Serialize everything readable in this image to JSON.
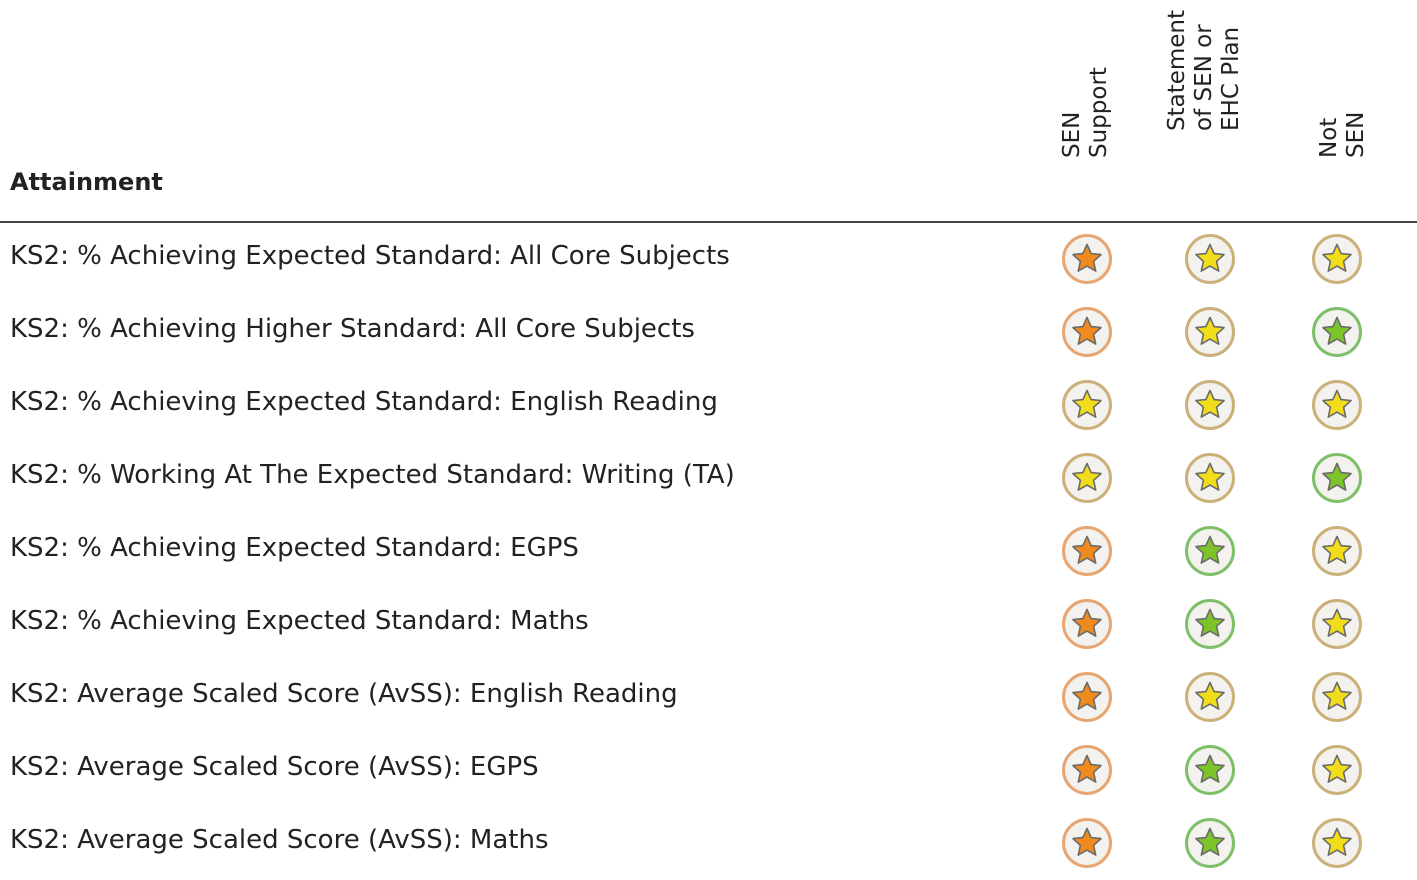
{
  "section": {
    "title": "Attainment"
  },
  "columns": [
    {
      "lines": [
        "SEN",
        "Support"
      ]
    },
    {
      "lines": [
        "Statement",
        "of SEN or",
        "EHC Plan"
      ]
    },
    {
      "lines": [
        "Not",
        "SEN"
      ]
    }
  ],
  "rating_colors": {
    "orange": "#f08a1c",
    "yellow": "#f2dd1a",
    "green": "#7cc428"
  },
  "rating_icon": "star-icon",
  "rows": [
    {
      "label": "KS2: % Achieving Expected Standard: All Core Subjects",
      "ratings": [
        "orange",
        "yellow",
        "yellow"
      ]
    },
    {
      "label": "KS2: % Achieving Higher Standard: All Core Subjects",
      "ratings": [
        "orange",
        "yellow",
        "green"
      ]
    },
    {
      "label": "KS2: % Achieving Expected Standard: English Reading",
      "ratings": [
        "yellow",
        "yellow",
        "yellow"
      ]
    },
    {
      "label": "KS2: % Working At The Expected Standard: Writing (TA)",
      "ratings": [
        "yellow",
        "yellow",
        "green"
      ]
    },
    {
      "label": "KS2: % Achieving Expected Standard: EGPS",
      "ratings": [
        "orange",
        "green",
        "yellow"
      ]
    },
    {
      "label": "KS2: % Achieving Expected Standard: Maths",
      "ratings": [
        "orange",
        "green",
        "yellow"
      ]
    },
    {
      "label": "KS2: Average Scaled Score (AvSS): English Reading",
      "ratings": [
        "orange",
        "yellow",
        "yellow"
      ]
    },
    {
      "label": "KS2: Average Scaled Score (AvSS): EGPS",
      "ratings": [
        "orange",
        "green",
        "yellow"
      ]
    },
    {
      "label": "KS2: Average Scaled Score (AvSS): Maths",
      "ratings": [
        "orange",
        "green",
        "yellow"
      ]
    }
  ]
}
